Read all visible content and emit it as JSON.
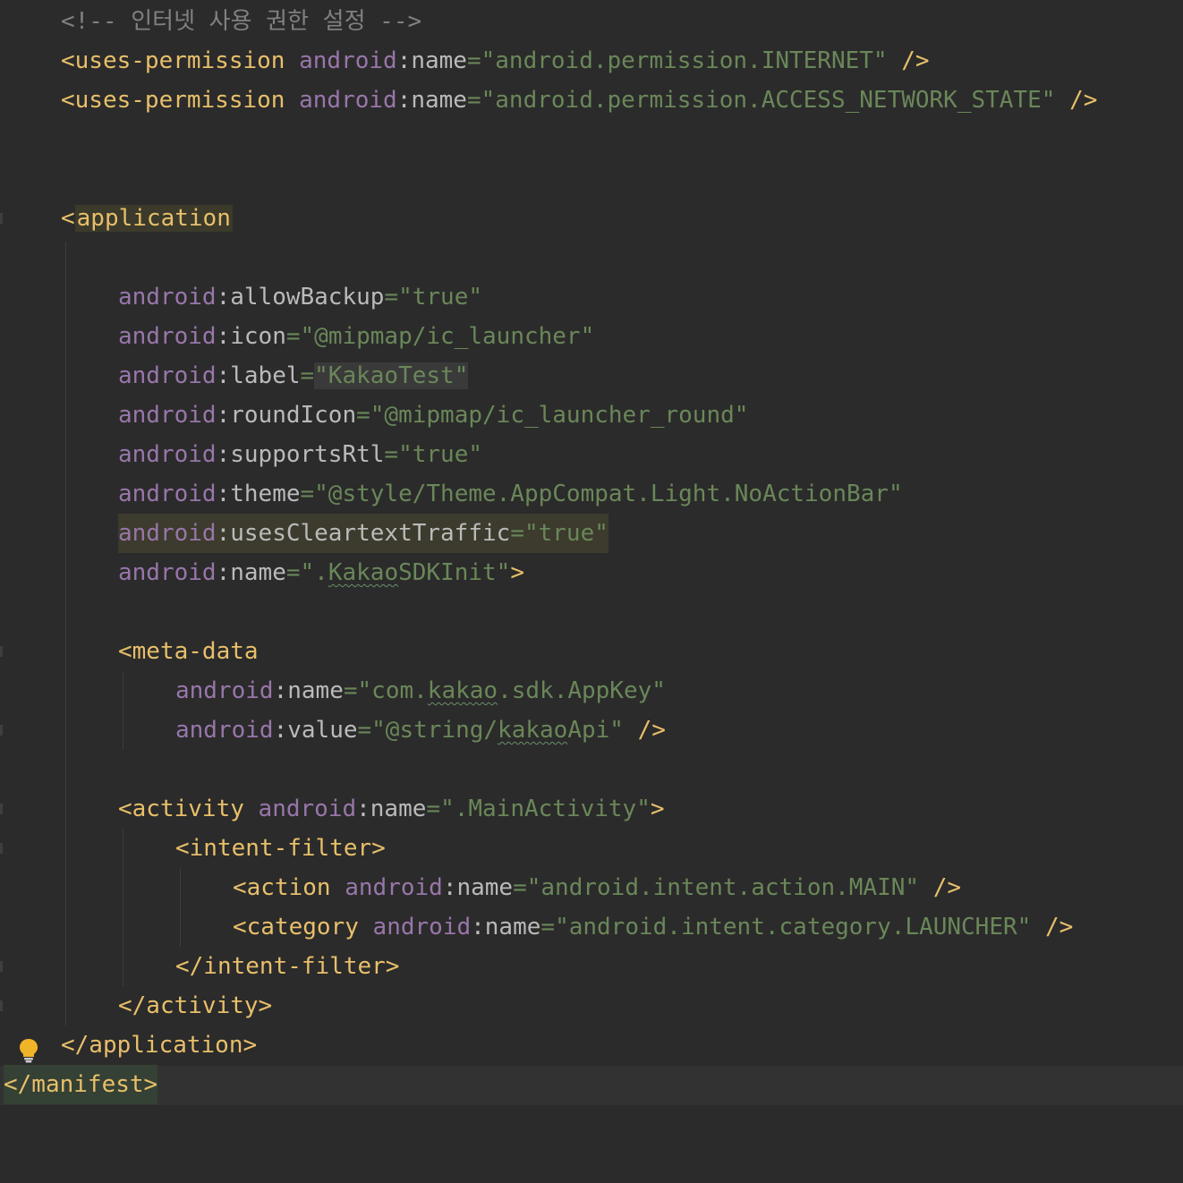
{
  "editor": {
    "lines": {
      "comment": "<!-- 인터넷 사용 권한 설정 -->",
      "perm1": {
        "tag_open": "<uses-permission",
        "ns": "android",
        "colon": ":",
        "attr": "name",
        "eq": "=",
        "value": "\"android.permission.INTERNET\"",
        "close": "/>"
      },
      "perm2": {
        "tag_open": "<uses-permission",
        "ns": "android",
        "colon": ":",
        "attr": "name",
        "eq": "=",
        "value": "\"android.permission.ACCESS_NETWORK_STATE\"",
        "close": "/>"
      },
      "application_open": {
        "lt": "<",
        "name": "application"
      },
      "allow_backup": {
        "ns": "android",
        "attr": ":allowBackup",
        "eq": "=",
        "value": "\"true\""
      },
      "icon": {
        "ns": "android",
        "attr": ":icon",
        "eq": "=",
        "value": "\"@mipmap/ic_launcher\""
      },
      "label": {
        "ns": "android",
        "attr": ":label",
        "eq": "=",
        "value": "\"KakaoTest\""
      },
      "round_icon": {
        "ns": "android",
        "attr": ":roundIcon",
        "eq": "=",
        "value": "\"@mipmap/ic_launcher_round\""
      },
      "supports_rtl": {
        "ns": "android",
        "attr": ":supportsRtl",
        "eq": "=",
        "value": "\"true\""
      },
      "theme": {
        "ns": "android",
        "attr": ":theme",
        "eq": "=",
        "value": "\"@style/Theme.AppCompat.Light.NoActionBar\""
      },
      "cleartext": {
        "ns": "android",
        "attr": ":usesCleartextTraffic",
        "eq": "=",
        "value": "\"true\""
      },
      "app_name": {
        "ns": "android",
        "attr": ":name",
        "eq": "=",
        "value_open": "\".",
        "value_typo": "Kakao",
        "value_rest": "SDKInit\"",
        "close": ">"
      },
      "meta_open": "<meta-data",
      "meta_name": {
        "ns": "android",
        "attr": ":name",
        "eq": "=",
        "value_open": "\"com.",
        "value_typo": "kakao",
        "value_rest": ".sdk.AppKey\""
      },
      "meta_value": {
        "ns": "android",
        "attr": ":value",
        "eq": "=",
        "value_open": "\"@string/",
        "value_typo": "kakao",
        "value_rest": "Api\"",
        "close": "/>"
      },
      "activity_open": {
        "tag_open": "<activity",
        "ns": "android",
        "attr": ":name",
        "eq": "=",
        "value": "\".MainActivity\"",
        "close": ">"
      },
      "intent_open": "<intent-filter>",
      "action": {
        "tag_open": "<action",
        "ns": "android",
        "attr": ":name",
        "eq": "=",
        "value": "\"android.intent.action.MAIN\"",
        "close": "/>"
      },
      "category": {
        "tag_open": "<category",
        "ns": "android",
        "attr": ":name",
        "eq": "=",
        "value": "\"android.intent.category.LAUNCHER\"",
        "close": "/>"
      },
      "intent_close": "</intent-filter>",
      "activity_close": "</activity>",
      "application_close": "</application>",
      "manifest_close": "</manifest>"
    },
    "intention_icon": "lightbulb-icon"
  },
  "colors": {
    "background": "#2b2b2b",
    "tag": "#e8bf6a",
    "namespace": "#9876aa",
    "attribute": "#bababa",
    "string": "#6a8759",
    "comment": "#808080",
    "bulb": "#f0b429"
  }
}
